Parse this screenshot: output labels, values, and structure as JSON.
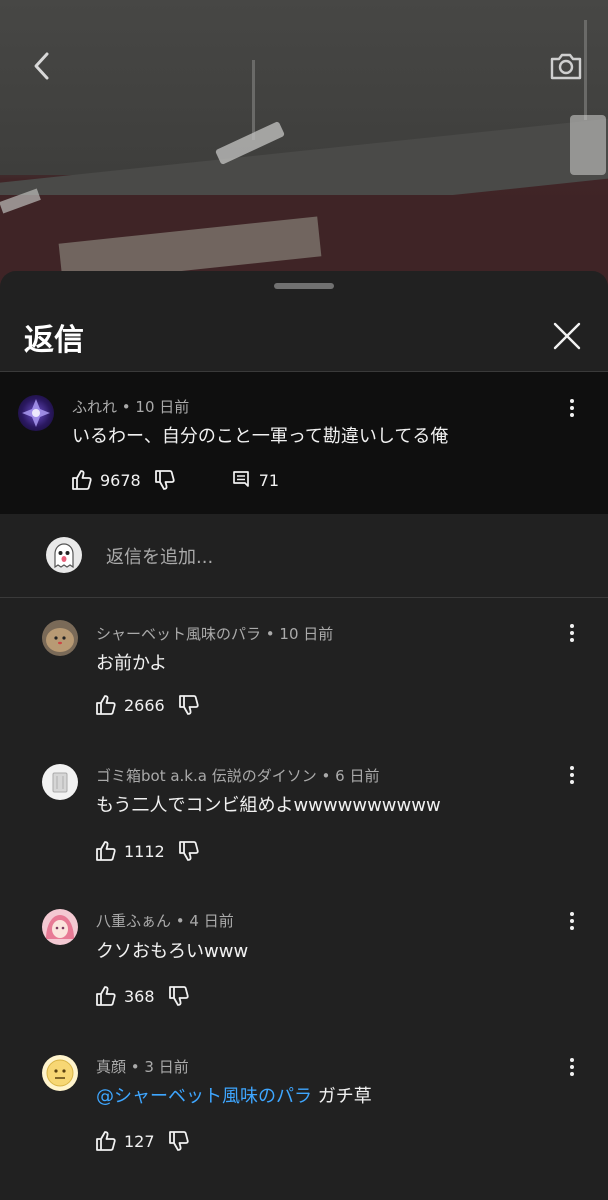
{
  "sheet": {
    "title": "返信",
    "add_reply_placeholder": "返信を追加..."
  },
  "parent_comment": {
    "author": "ふれれ",
    "time": "10 日前",
    "text": "いるわー、自分のこと一軍って勘違いしてる俺",
    "likes": "9678",
    "replies": "71"
  },
  "replies": [
    {
      "author": "シャーベット風味のパラ",
      "time": "10 日前",
      "mention": "",
      "text": "お前かよ",
      "likes": "2666"
    },
    {
      "author": "ゴミ箱bot a.k.a 伝説のダイソン",
      "time": "6 日前",
      "mention": "",
      "text": "もう二人でコンビ組めよwwwwwwwwww",
      "likes": "1112"
    },
    {
      "author": "八重ふぁん",
      "time": "4 日前",
      "mention": "",
      "text": "クソおもろいwww",
      "likes": "368"
    },
    {
      "author": "真顔",
      "time": "3 日前",
      "mention": "@シャーベット風味のパラ",
      "text": "ガチ草",
      "likes": "127"
    }
  ],
  "colors": {
    "accent_link": "#3ea6ff",
    "background": "#212121",
    "parent_background": "#0f0f0f"
  },
  "icons": [
    "back-icon",
    "camera-icon",
    "close-icon",
    "more-vert-icon",
    "thumb-up-icon",
    "thumb-down-icon",
    "comment-icon"
  ]
}
